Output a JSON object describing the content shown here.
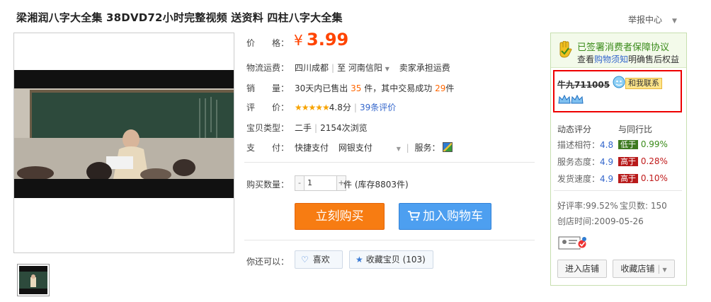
{
  "title": "梁湘润八字大全集 38DVD72小时完整视频 送资料 四柱八字大全集",
  "report": "举报中心",
  "price": {
    "label": "价　　格：",
    "symbol": "¥",
    "value": "3.99"
  },
  "shipping": {
    "label": "物流运费：",
    "from": "四川成都",
    "to_prefix": "至",
    "to": "河南信阳",
    "fee": "卖家承担运费"
  },
  "sales": {
    "label": "销　　量：",
    "prefix": "30天内已售出",
    "sold": "35",
    "mid": "件，其中交易成功",
    "success": "29",
    "suffix": "件"
  },
  "rating": {
    "label": "评　　价：",
    "stars": "★★★★★",
    "score": "4.8分",
    "reviews": "39条评价"
  },
  "type": {
    "label": "宝贝类型：",
    "value": "二手",
    "views": "2154次浏览"
  },
  "payment": {
    "label": "支　　付：",
    "option1": "快捷支付",
    "option2": "网银支付",
    "service_label": "服务："
  },
  "quantity": {
    "label": "购买数量：",
    "minus": "-",
    "value": "1",
    "plus": "+",
    "stock": "件 (库存8803件)"
  },
  "buttons": {
    "buy": "立刻购买",
    "cart": "加入购物车"
  },
  "also": {
    "label": "你还可以：",
    "like": "喜欢",
    "collect": "收藏宝贝 (103)"
  },
  "shop": {
    "guarantee_title": "已签署消费者保障协议",
    "guarantee_sub_prefix": "查看",
    "guarantee_link": "购物须知",
    "guarantee_sub_suffix": "明确售后权益",
    "seller": "牛九711005",
    "contact": "和我联系",
    "dsr_title": "动态评分",
    "dsr_compare": "与同行比",
    "dsr": [
      {
        "label": "描述相符：",
        "score": "4.8",
        "tag": "低于",
        "pct": "0.99%"
      },
      {
        "label": "服务态度：",
        "score": "4.9",
        "tag": "高于",
        "pct": "0.28%"
      },
      {
        "label": "发货速度：",
        "score": "4.9",
        "tag": "高于",
        "pct": "0.10%"
      }
    ],
    "good_rate": "好评率:99.52%",
    "item_count": "宝贝数: 150",
    "created": "创店时间:2009-05-26",
    "enter": "进入店铺",
    "collect": "收藏店铺"
  }
}
